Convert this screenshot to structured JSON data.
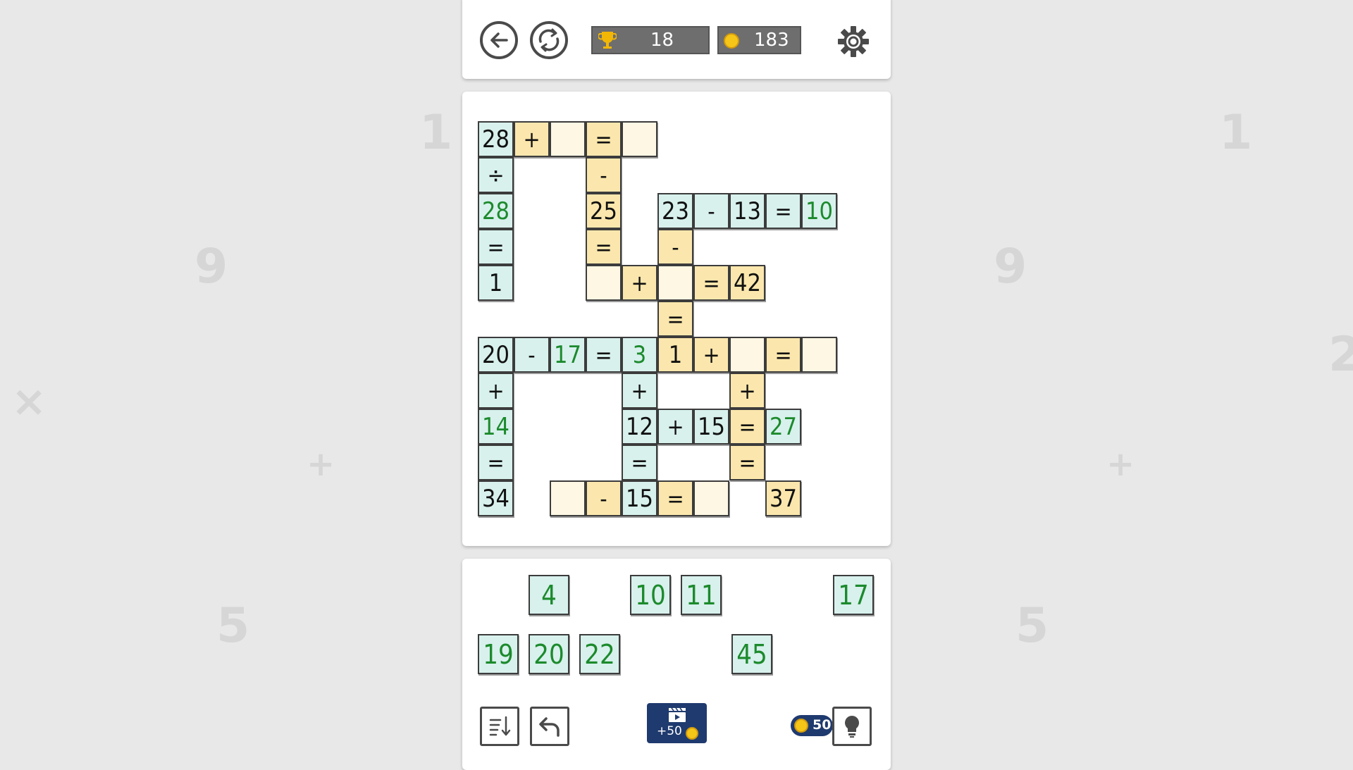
{
  "colors": {
    "background": "#e8e8e8",
    "panel": "#ffffff",
    "tile_cyan": "#d8f1ed",
    "tile_yellow": "#fbe7ad",
    "tile_blank": "#fdf7e4",
    "answer_green": "#1c8a2c",
    "counter_gray": "#6e6e6e",
    "button_navy": "#1f3a6e",
    "coin_gold": "#f5c518"
  },
  "background_symbols": [
    "1",
    "1",
    "9",
    "9",
    "2",
    "×",
    "+",
    "+",
    "5",
    "5"
  ],
  "header": {
    "back_icon": "arrow-left-icon",
    "restart_icon": "restart-icon",
    "trophy_icon": "trophy-icon",
    "trophy_count": "18",
    "coin_icon": "coin-icon",
    "coin_count": "183",
    "settings_icon": "gear-icon"
  },
  "board": {
    "rows": [
      [
        "28",
        "+",
        "",
        "=",
        "",
        null,
        null,
        null,
        null,
        null,
        null
      ],
      [
        "÷",
        null,
        null,
        "-",
        null,
        null,
        null,
        null,
        null,
        null,
        null
      ],
      [
        "28",
        null,
        null,
        "25",
        null,
        "23",
        "-",
        "13",
        "=",
        "10",
        null
      ],
      [
        "=",
        null,
        null,
        "=",
        null,
        "-",
        null,
        null,
        null,
        null,
        null
      ],
      [
        "1",
        null,
        null,
        "",
        "+",
        "",
        "=",
        "42",
        null,
        null,
        null
      ],
      [
        null,
        null,
        null,
        null,
        null,
        "=",
        null,
        null,
        null,
        null,
        null
      ],
      [
        "20",
        "-",
        "17",
        "=",
        "3",
        "1",
        "+",
        "",
        "=",
        "",
        null
      ],
      [
        "+",
        null,
        null,
        null,
        "+",
        null,
        null,
        "+",
        null,
        null,
        null
      ],
      [
        "14",
        null,
        null,
        null,
        "12",
        "+",
        "15",
        "=",
        "27",
        null,
        null
      ],
      [
        "=",
        null,
        null,
        null,
        "=",
        null,
        null,
        "=",
        null,
        null,
        null
      ],
      [
        "34",
        null,
        "",
        "-",
        "15",
        "=",
        "",
        null,
        "37",
        null,
        null
      ]
    ]
  },
  "tray": {
    "top_row": [
      "4",
      "10",
      "11",
      "17"
    ],
    "bottom_row": [
      "19",
      "20",
      "22",
      "45"
    ]
  },
  "controls": {
    "sort_icon": "sort-icon",
    "undo_icon": "undo-icon",
    "video_icon": "video-reward-icon",
    "video_reward_label": "+50",
    "hint_cost": "50",
    "hint_icon": "lightbulb-icon"
  }
}
